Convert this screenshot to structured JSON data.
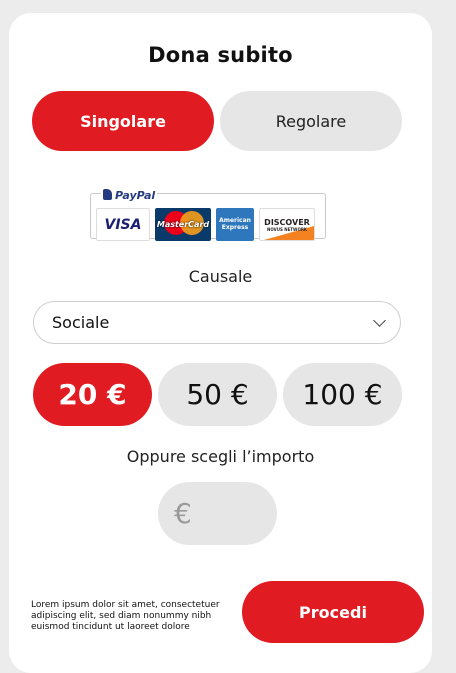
{
  "form": {
    "title": "Dona subito",
    "frequency": {
      "options": [
        "Singolare",
        "Regolare"
      ],
      "selected": "Singolare"
    },
    "payment": {
      "provider": "PayPal",
      "cards": [
        "VISA",
        "MasterCard",
        "American Express",
        "DISCOVER"
      ],
      "discover_sub": "NOVUS NETWORK"
    },
    "causale": {
      "label": "Causale",
      "value": "Sociale"
    },
    "amounts": [
      "20 €",
      "50 €",
      "100 €"
    ],
    "selected_amount": "20 €",
    "custom": {
      "label": "Oppure scegli l’importo",
      "placeholder": "€"
    },
    "disclaimer": "Lorem ipsum dolor sit amet, consectetuer adipiscing elit, sed diam nonummy nibh euismod tincidunt ut laoreet dolore",
    "submit_label": "Procedi"
  },
  "colors": {
    "accent": "#e11b22",
    "inactive": "#e6e6e6",
    "background": "#ececec"
  }
}
